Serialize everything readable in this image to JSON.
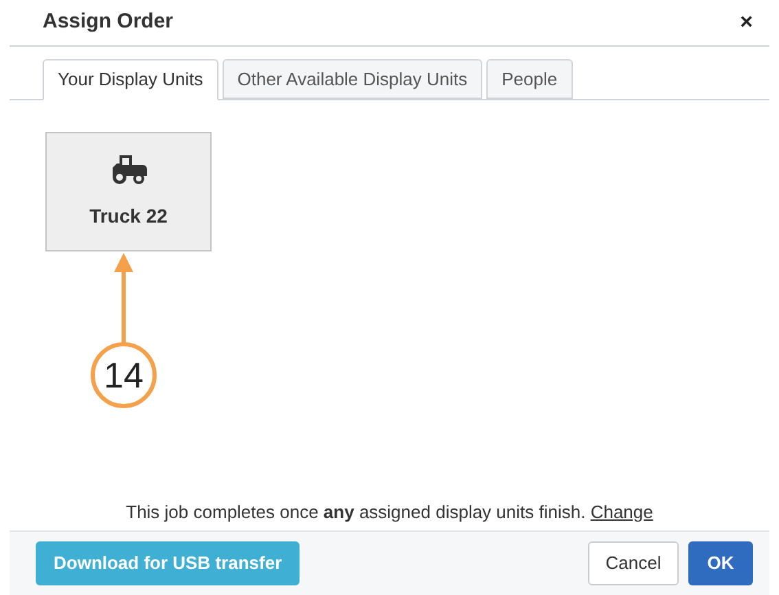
{
  "dialog": {
    "title": "Assign Order",
    "close": "×"
  },
  "tabs": [
    {
      "label": "Your Display Units",
      "selected": true
    },
    {
      "label": "Other Available Display Units",
      "selected": false
    },
    {
      "label": "People",
      "selected": false
    }
  ],
  "units": [
    {
      "name": "Truck 22"
    }
  ],
  "callout": {
    "number": "14"
  },
  "completion": {
    "text": "This job completes once **any** assigned display units finish.",
    "link": "Change"
  },
  "buttons": {
    "download": "Download for USB transfer",
    "cancel": "Cancel",
    "ok": "OK"
  }
}
